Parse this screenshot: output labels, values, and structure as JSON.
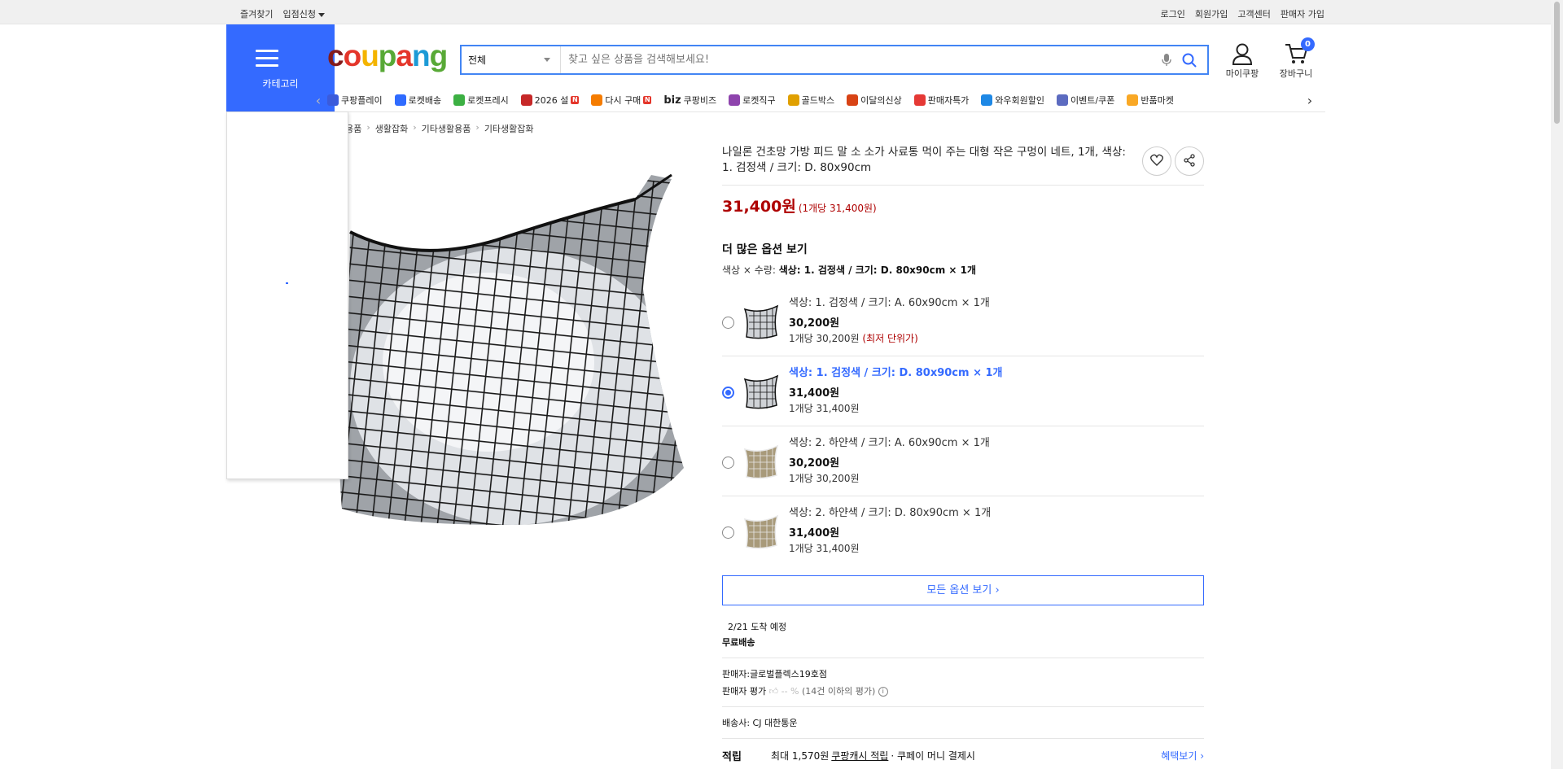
{
  "topbar": {
    "left": [
      "즐겨찾기",
      "입점신청"
    ],
    "right": [
      "로그인",
      "회원가입",
      "고객센터",
      "판매자 가입"
    ]
  },
  "header": {
    "category_label": "카테고리",
    "search_category": "전체",
    "search_placeholder": "찾고 싶은 상품을 검색해보세요!",
    "mycoupang_label": "마이쿠팡",
    "cart_label": "장바구니",
    "cart_count": "0"
  },
  "catnav": [
    {
      "label": "쿠팡플레이",
      "color": "#3b5bdb"
    },
    {
      "label": "로켓배송",
      "color": "#2f6bff"
    },
    {
      "label": "로켓프레시",
      "color": "#3cb043"
    },
    {
      "label": "2026 설",
      "color": "#c62828"
    },
    {
      "label": "다시 구매",
      "color": "#f57c00"
    },
    {
      "label": "쿠팡비즈",
      "color": "#111111"
    },
    {
      "label": "로켓직구",
      "color": "#8e44ad"
    },
    {
      "label": "골드박스",
      "color": "#e0a000"
    },
    {
      "label": "이달의신상",
      "color": "#d84315"
    },
    {
      "label": "판매자특가",
      "color": "#e53935"
    },
    {
      "label": "와우회원할인",
      "color": "#1e88e5"
    },
    {
      "label": "이벤트/쿠폰",
      "color": "#5c6bc0"
    },
    {
      "label": "반품마켓",
      "color": "#f9a825"
    }
  ],
  "catnav_biz": "biz",
  "breadcrumb": [
    "활용품",
    "생활잡화",
    "기타생활용품",
    "기타생활잡화"
  ],
  "product": {
    "title": "나일론 건초망 가방 피드 말 소 소가 사료통 먹이 주는 대형 작은 구멍이 네트, 1개, 색상: 1. 검정색 / 크기: D. 80x90cm",
    "price": "31,400원",
    "unit_price": "(1개당 31,400원)",
    "more_options": "더 많은 옵션 보기",
    "selection_label": "색상 × 수량:",
    "selection_value": "색상: 1. 검정색 / 크기: D. 80x90cm × 1개",
    "options": [
      {
        "name": "색상: 1. 검정색 / 크기: A. 60x90cm × 1개",
        "price": "30,200원",
        "unit": "1개당 30,200원",
        "note": "(최저 단위가)",
        "selected": false,
        "color": "black"
      },
      {
        "name": "색상: 1. 검정색 / 크기: D. 80x90cm × 1개",
        "price": "31,400원",
        "unit": "1개당 31,400원",
        "note": "",
        "selected": true,
        "color": "black"
      },
      {
        "name": "색상: 2. 하얀색 / 크기: A. 60x90cm × 1개",
        "price": "30,200원",
        "unit": "1개당 30,200원",
        "note": "",
        "selected": false,
        "color": "white"
      },
      {
        "name": "색상: 2. 하얀색 / 크기: D. 80x90cm × 1개",
        "price": "31,400원",
        "unit": "1개당 31,400원",
        "note": "",
        "selected": false,
        "color": "white"
      }
    ],
    "all_options_label": "모든 옵션 보기 ›",
    "arrival": "2/21 도착 예정",
    "free_shipping": "무료배송",
    "seller": "판매자:글로벌플렉스19호점",
    "seller_rating_label": "판매자 평가",
    "seller_rating_value": "-- %",
    "seller_rating_note": "(14건 이하의 평가)",
    "carrier": "배송사:  CJ 대한통운",
    "points_label": "적립",
    "points_max": "최대 1,570원",
    "points_link": "쿠팡캐시 적립",
    "points_suffix": "· 쿠페이 머니 결제시",
    "benefit_link": "혜택보기 ›"
  }
}
